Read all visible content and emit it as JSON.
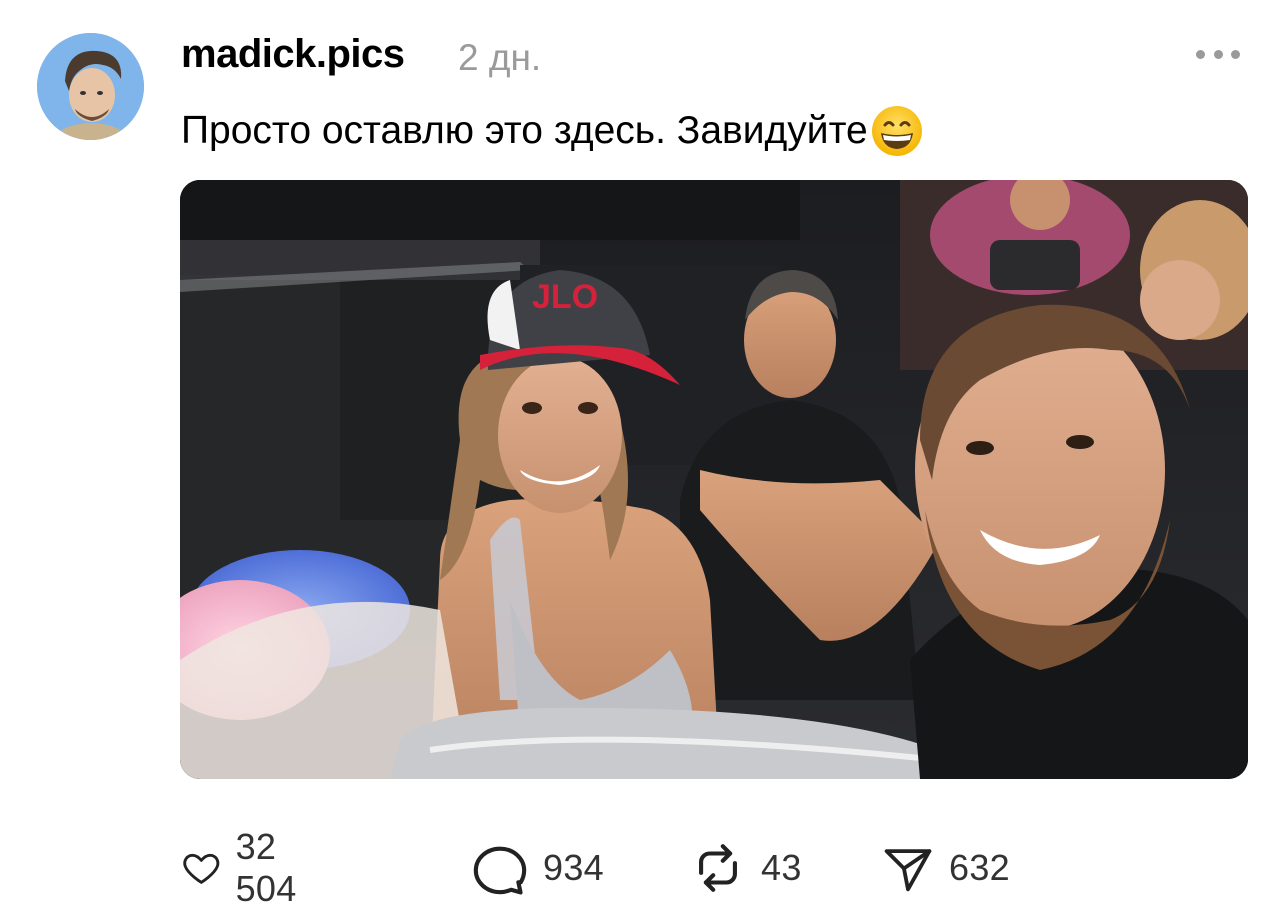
{
  "post": {
    "username": "madick.pics",
    "time": "2 дн.",
    "caption": "Просто оставлю это здесь. Завидуйте",
    "caption_emoji": "grinning-face-with-smiling-eyes",
    "more_icon": "more-horizontal-icon"
  },
  "actions": {
    "likes": "32 504",
    "comments": "934",
    "reposts": "43",
    "shares": "632"
  },
  "photo": {
    "cap_text": "JLO"
  },
  "colors": {
    "muted_text": "#9a9a9a",
    "icon_stroke": "#222222",
    "cap_red": "#d6213a"
  }
}
